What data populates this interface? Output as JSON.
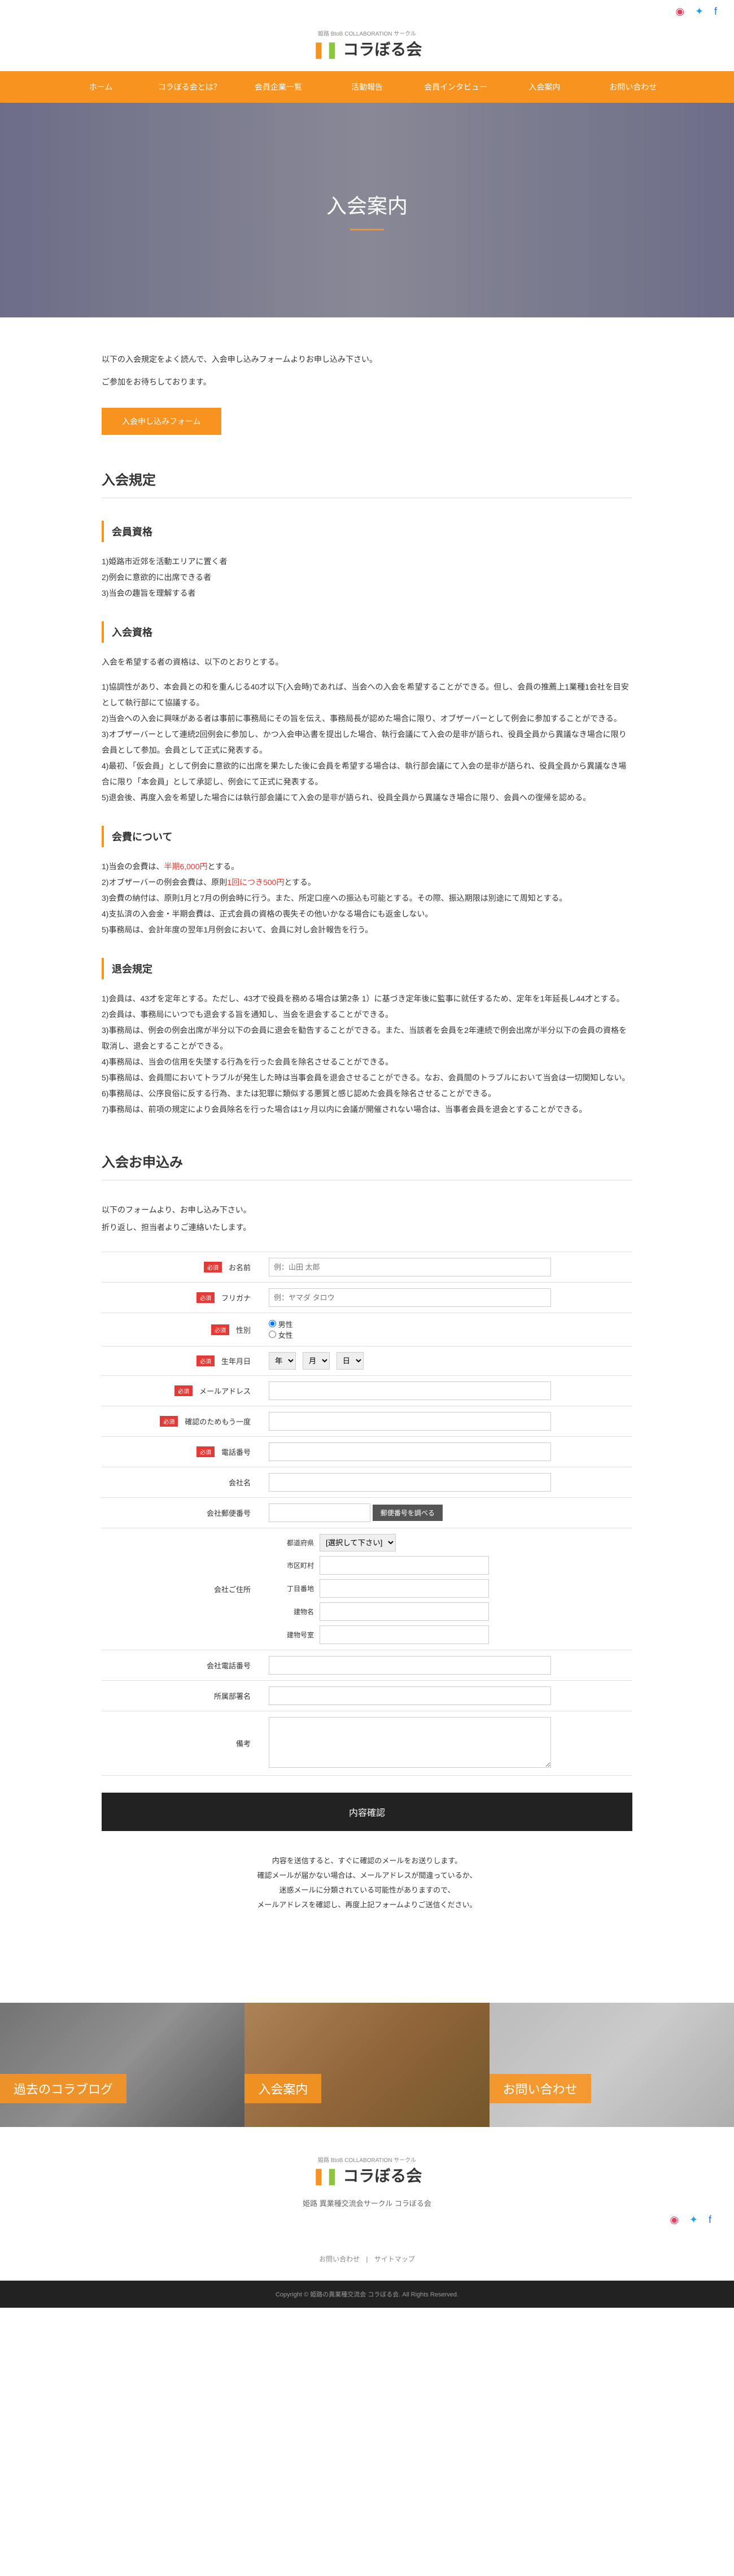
{
  "social": {
    "instagram": "●",
    "twitter": "●",
    "facebook": "●"
  },
  "logo": {
    "sub": "姫路 BtoB COLLABORATION サークル",
    "text": "コラぼる会"
  },
  "nav": [
    {
      "label": "ホーム"
    },
    {
      "label": "コラぼる会とは？"
    },
    {
      "label": "会員企業一覧"
    },
    {
      "label": "活動報告"
    },
    {
      "label": "会員インタビュー"
    },
    {
      "label": "入会案内"
    },
    {
      "label": "お問い合わせ"
    }
  ],
  "hero": {
    "title": "入会案内"
  },
  "intro": {
    "p1": "以下の入会規定をよく読んで、入会申し込みフォームよりお申し込み下さい。",
    "p2": "ご参加をお待ちしております。",
    "btn": "入会申し込みフォーム"
  },
  "sec_rules_title": "入会規定",
  "sub_qualify": "会員資格",
  "qualify_items": [
    "1)姫路市近郊を活動エリアに置く者",
    "2)例会に意欲的に出席できる者",
    "3)当会の趣旨を理解する者"
  ],
  "sub_apply": "入会資格",
  "apply_lead": "入会を希望する者の資格は、以下のとおりとする。",
  "apply_items": [
    "1)協調性があり、本会員との和を重んじる40才以下(入会時)であれば、当会への入会を希望することができる。但し、会員の推薦上1業種1会社を目安として執行部にて協議する。",
    "2)当会への入会に興味がある者は事前に事務局にその旨を伝え、事務局長が認めた場合に限り、オブザーバーとして例会に参加することができる。",
    "3)オブザーバーとして連続2回例会に参加し、かつ入会申込書を提出した場合、執行会議にて入会の是非が語られ、役員全員から異議なき場合に限り会員として参加。会員として正式に発表する。",
    "4)最初、「仮会員」として例会に意欲的に出席を果たした後に会員を希望する場合は、執行部会議にて入会の是非が語られ、役員全員から異議なき場合に限り「本会員」として承認し、例会にて正式に発表する。",
    "5)退会後、再度入会を希望した場合には執行部会議にて入会の是非が語られ、役員全員から異議なき場合に限り、会員への復帰を認める。"
  ],
  "sub_fee": "会費について",
  "fee_items": [
    {
      "pre": "1)当会の会費は、",
      "red": "半期6,000円",
      "post": "とする。"
    },
    {
      "pre": "2)オブザーバーの例会会費は、原則",
      "red": "1回につき500円",
      "post": "とする。"
    },
    {
      "pre": "3)会費の納付は、原則1月と7月の例会時に行う。また、所定口座への振込も可能とする。その際、振込期限は別途にて周知とする。",
      "red": "",
      "post": ""
    },
    {
      "pre": "4)支払済の入会金・半期会費は、正式会員の資格の喪失その他いかなる場合にも返金しない。",
      "red": "",
      "post": ""
    },
    {
      "pre": "5)事務局は、会計年度の翌年1月例会において、会員に対し会計報告を行う。",
      "red": "",
      "post": ""
    }
  ],
  "sub_withdraw": "退会規定",
  "withdraw_items": [
    "1)会員は、43才を定年とする。ただし、43才で役員を務める場合は第2条 1）に基づき定年後に監事に就任するため、定年を1年延長し44才とする。",
    "2)会員は、事務局にいつでも退会する旨を通知し、当会を退会することができる。",
    "3)事務局は、例会の例会出席が半分以下の会員に退会を勧告することができる。また、当該者を会員を2年連続で例会出席が半分以下の会員の資格を取消し、退会とすることができる。",
    "4)事務局は、当会の信用を失墜する行為を行った会員を除名させることができる。",
    "5)事務局は、会員間においてトラブルが発生した時は当事会員を退会させることができる。なお、会員間のトラブルにおいて当会は一切関知しない。",
    "6)事務局は、公序良俗に反する行為、または犯罪に類似する悪質と感じ認めた会員を除名させることができる。",
    "7)事務局は、前項の規定により会員除名を行った場合は1ヶ月以内に会議が開催されない場合は、当事者会員を退会とすることができる。"
  ],
  "sec_form_title": "入会お申込み",
  "form_note": {
    "p1": "以下のフォームより、お申し込み下さい。",
    "p2": "折り返し、担当者よりご連絡いたします。"
  },
  "req_label": "必須",
  "form": {
    "name": {
      "label": "お名前",
      "ph": "例：山田 太郎"
    },
    "kana": {
      "label": "フリガナ",
      "ph": "例：ヤマダ タロウ"
    },
    "gender": {
      "label": "性別",
      "opts": [
        "男性",
        "女性"
      ]
    },
    "birth": {
      "label": "生年月日",
      "y": "年",
      "m": "月",
      "d": "日"
    },
    "email": {
      "label": "メールアドレス"
    },
    "email2": {
      "label": "確認のためもう一度"
    },
    "tel": {
      "label": "電話番号"
    },
    "company": {
      "label": "会社名"
    },
    "czip": {
      "label": "会社郵便番号",
      "btn": "郵便番号を調べる"
    },
    "caddr": {
      "label": "会社ご住所",
      "pref": "都道府県",
      "pref_ph": "[選択して下さい]",
      "city": "市区町村",
      "street": "丁目番地",
      "bldg": "建物名",
      "room": "建物号室"
    },
    "ctel": {
      "label": "会社電話番号"
    },
    "dept": {
      "label": "所属部署名"
    },
    "note": {
      "label": "備考"
    }
  },
  "submit": "内容確認",
  "after": [
    "内容を送信すると、すぐに確認のメールをお送りします。",
    "確認メールが届かない場合は、メールアドレスが間違っているか、",
    "迷惑メールに分類されている可能性がありますので、",
    "メールアドレスを確認し、再度上記フォームよりご送信ください。"
  ],
  "tri": [
    {
      "label": "過去のコラブログ"
    },
    {
      "label": "入会案内"
    },
    {
      "label": "お問い合わせ"
    }
  ],
  "footer_name": "姫路 異業種交流会サークル コラぼる会",
  "footer_links": [
    {
      "label": "お問い合わせ"
    },
    {
      "label": "サイトマップ"
    }
  ],
  "copyright": "Copyright © 姫路の異業種交流会 コラぼる会. All Rights Reserved."
}
